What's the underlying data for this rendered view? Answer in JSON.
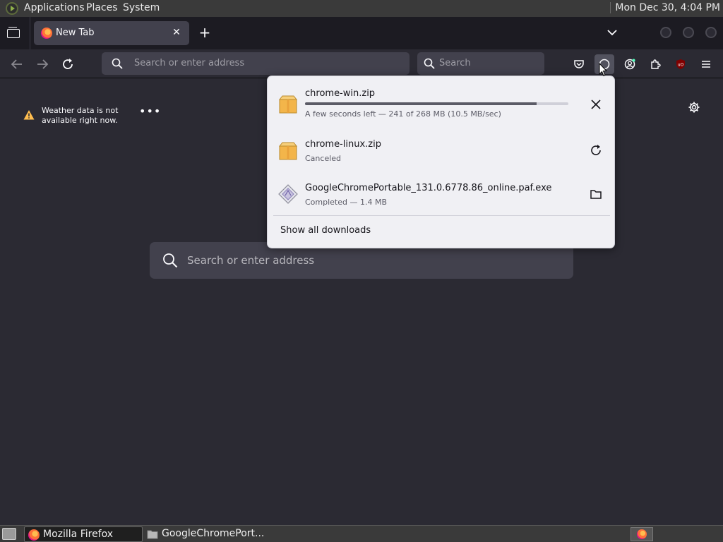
{
  "top_panel": {
    "menus": [
      "Applications",
      "Places",
      "System"
    ],
    "clock": "Mon Dec 30,  4:04 PM"
  },
  "tabs": [
    {
      "title": "New Tab",
      "active": true
    }
  ],
  "navbar": {
    "url_placeholder": "Search or enter address",
    "search_placeholder": "Search"
  },
  "newtab": {
    "weather_message": "Weather data is not available right now.",
    "search_placeholder": "Search or enter address"
  },
  "downloads": {
    "items": [
      {
        "name": "chrome-win.zip",
        "status": "A few seconds left — 241 of 268 MB (10.5 MB/sec)",
        "progress": 0.9,
        "action": "cancel",
        "icon": "zip-archive-icon"
      },
      {
        "name": "chrome-linux.zip",
        "status": "Canceled",
        "action": "retry",
        "icon": "zip-archive-icon"
      },
      {
        "name": "GoogleChromePortable_131.0.6778.86_online.paf.exe",
        "status": "Completed — 1.4 MB",
        "action": "show-in-folder",
        "icon": "executable-icon"
      }
    ],
    "show_all_label": "Show all downloads"
  },
  "taskbar": {
    "tasks": [
      {
        "label": "Mozilla Firefox",
        "active": true
      },
      {
        "label": "GoogleChromePort...",
        "active": false
      }
    ]
  },
  "colors": {
    "page_bg": "#2b2a33",
    "toolbar_bg": "#42414d",
    "panel_bg": "#f0f0f4",
    "folder_orange": "#f3b54a",
    "warning": "#ffbd4f"
  }
}
